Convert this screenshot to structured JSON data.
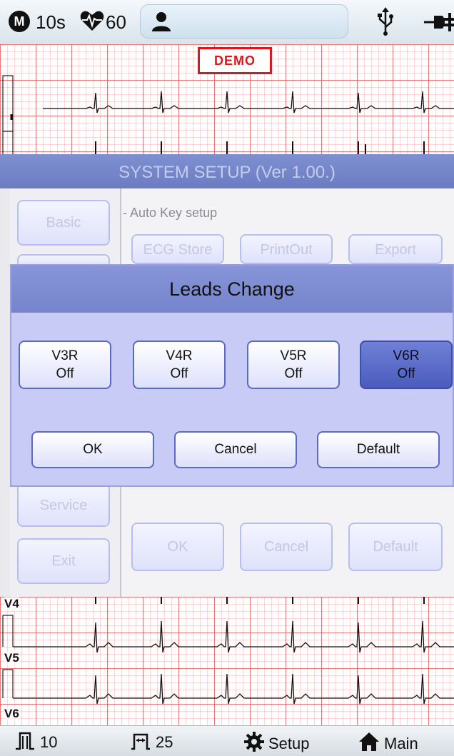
{
  "topbar": {
    "mode": "M",
    "duration": "10s",
    "heart_rate": "60",
    "icons": [
      "mode-badge-icon",
      "heart-icon",
      "patient-icon",
      "usb-icon",
      "power-plug-icon"
    ]
  },
  "ecg": {
    "demo_label": "DEMO",
    "bottom_leads": [
      "V4",
      "V5",
      "V6"
    ]
  },
  "setup": {
    "title": "SYSTEM SETUP (Ver 1.00.)",
    "menu": [
      "Basic",
      "Service",
      "Exit"
    ],
    "auto_key_label": "Auto Key setup",
    "auto_key_buttons": [
      "ECG Store",
      "PrintOut",
      "Export"
    ],
    "actions": [
      "OK",
      "Cancel",
      "Default"
    ]
  },
  "dialog": {
    "title": "Leads Change",
    "leads": [
      {
        "name": "V3R",
        "state": "Off",
        "selected": false
      },
      {
        "name": "V4R",
        "state": "Off",
        "selected": false
      },
      {
        "name": "V5R",
        "state": "Off",
        "selected": false
      },
      {
        "name": "V6R",
        "state": "Off",
        "selected": true
      }
    ],
    "ok": "OK",
    "cancel": "Cancel",
    "default": "Default"
  },
  "bottombar": {
    "gain": "10",
    "speed": "25",
    "setup": "Setup",
    "main": "Main"
  },
  "colors": {
    "accent": "#6b7cc3",
    "selected": "#4a5cbd",
    "demo_red": "#e0141c",
    "grid_red": "#e85555"
  }
}
